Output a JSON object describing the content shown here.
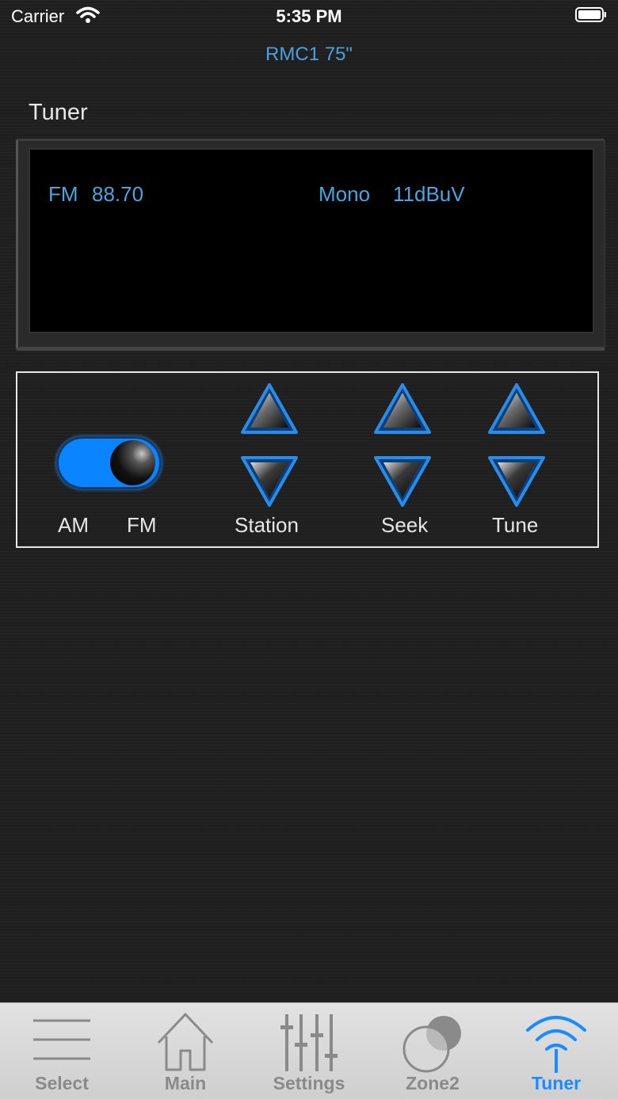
{
  "status_bar": {
    "carrier": "Carrier",
    "time": "5:35 PM"
  },
  "nav": {
    "title": "RMC1 75\""
  },
  "section": {
    "title": "Tuner"
  },
  "display": {
    "band": "FM",
    "frequency": "88.70",
    "mode": "Mono",
    "signal": "11dBuV"
  },
  "controls": {
    "band_toggle": {
      "left_label": "AM",
      "right_label": "FM",
      "selected": "FM"
    },
    "station_label": "Station",
    "seek_label": "Seek",
    "tune_label": "Tune"
  },
  "tab_bar": {
    "tabs": [
      {
        "label": "Select",
        "icon": "menu-lines-icon"
      },
      {
        "label": "Main",
        "icon": "home-icon"
      },
      {
        "label": "Settings",
        "icon": "sliders-icon"
      },
      {
        "label": "Zone2",
        "icon": "zone-circles-icon"
      },
      {
        "label": "Tuner",
        "icon": "wifi-signal-icon",
        "active": true
      }
    ]
  },
  "colors": {
    "accent": "#1a8cff",
    "display_text": "#46a6e2",
    "toggle_on": "#0a84ff"
  }
}
